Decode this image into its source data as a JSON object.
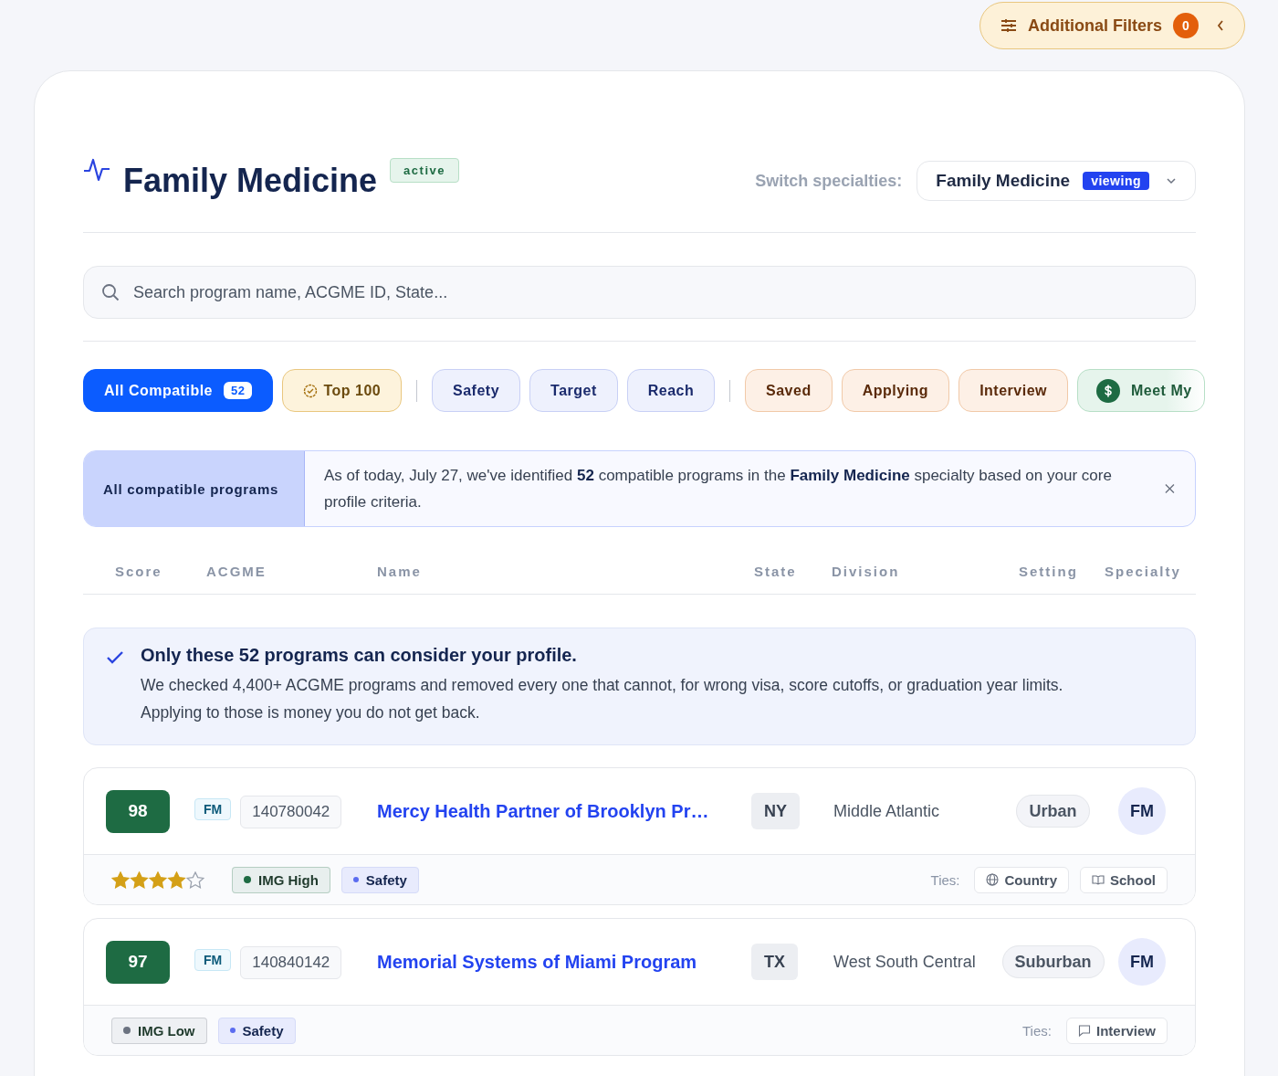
{
  "additional_filters": {
    "label": "Additional Filters",
    "count": "0"
  },
  "header": {
    "title": "Family Medicine",
    "status_badge": "active",
    "switch_label": "Switch specialties:",
    "specialty_select": {
      "value": "Family Medicine",
      "badge": "viewing"
    }
  },
  "search": {
    "placeholder": "Search program name, ACGME ID, State..."
  },
  "filter_groups": [
    [
      {
        "label": "All Compatible",
        "count": "52",
        "kind": "primary",
        "selected": true
      },
      {
        "label": "Top 100",
        "kind": "top",
        "selected": false
      }
    ],
    [
      {
        "label": "Safety",
        "kind": "tier",
        "selected": false
      },
      {
        "label": "Target",
        "kind": "tier",
        "selected": false
      },
      {
        "label": "Reach",
        "kind": "tier",
        "selected": false
      }
    ],
    [
      {
        "label": "Saved",
        "kind": "status",
        "selected": false
      },
      {
        "label": "Applying",
        "kind": "status",
        "selected": false
      },
      {
        "label": "Interview",
        "kind": "status",
        "selected": false
      },
      {
        "label": "Meet My",
        "kind": "money",
        "selected": false
      }
    ]
  ],
  "info_banner": {
    "label": "All compatible programs",
    "text": "As of today, July 27, we've identified **52** compatible programs in the **Family Medicine** specialty based on your core profile criteria."
  },
  "table": {
    "columns": [
      "Score",
      "ACGME",
      "Name",
      "State",
      "Division",
      "Setting",
      "Specialty"
    ],
    "notice": {
      "title": "Only these 52 programs can consider your profile.",
      "text": "We checked 4,400+ ACGME programs and removed every one that cannot, for wrong visa, score cutoffs, or graduation year limits. Applying to those is money you do not get back."
    },
    "rows": [
      {
        "score": "98",
        "code": "FM",
        "acgme": "140780042",
        "name": "Mercy Health Partner of Brooklyn Pr…",
        "state": "NY",
        "division": "Middle Atlantic",
        "setting": "Urban",
        "specialty": "FM",
        "stars": 4,
        "tags": [
          {
            "label": "IMG High",
            "kind": "img",
            "color": "#1e6b43"
          },
          {
            "label": "Safety",
            "kind": "tier",
            "color": "#5b6cf0"
          }
        ],
        "ties_label": "Ties:",
        "ties": [
          {
            "label": "Country",
            "kind": "country"
          },
          {
            "label": "School",
            "kind": "school"
          }
        ]
      },
      {
        "score": "97",
        "code": "FM",
        "acgme": "140840142",
        "name": "Memorial Systems of Miami Program",
        "state": "TX",
        "division": "West South Central",
        "setting": "Suburban",
        "specialty": "FM",
        "tags": [
          {
            "label": "IMG Low",
            "kind": "img",
            "color": "#6b7280"
          },
          {
            "label": "Safety",
            "kind": "tier",
            "color": "#5b6cf0"
          }
        ],
        "ties_label": "Ties:",
        "ties": [
          {
            "label": "Interview",
            "kind": "interview"
          }
        ]
      }
    ]
  }
}
